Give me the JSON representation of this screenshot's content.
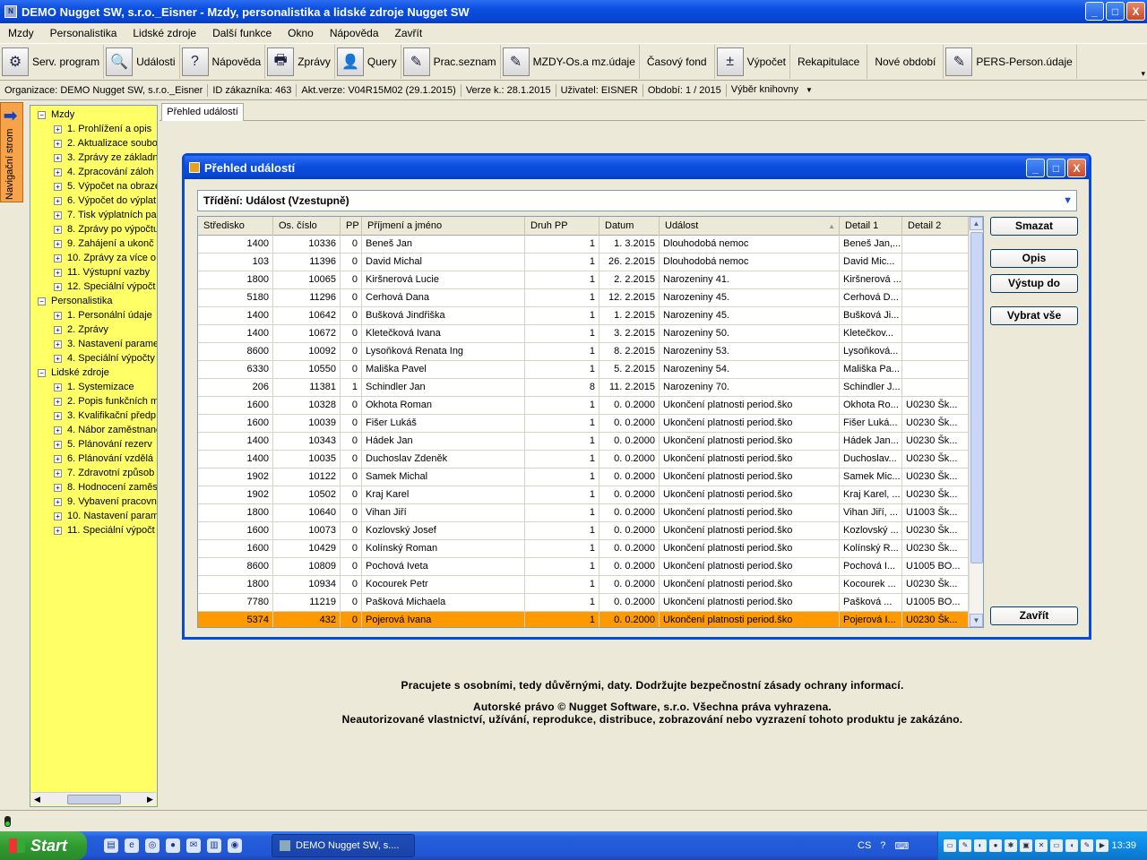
{
  "window": {
    "title": "DEMO Nugget SW, s.r.o._Eisner - Mzdy, personalistika a lidské zdroje Nugget SW",
    "minimize": "_",
    "maximize": "□",
    "close": "X"
  },
  "menu": [
    "Mzdy",
    "Personalistika",
    "Lidské zdroje",
    "Další funkce",
    "Okno",
    "Nápověda",
    "Zavřít"
  ],
  "toolbar": [
    {
      "label": "Serv. program",
      "icon": "gear-icon",
      "glyph": "⚙"
    },
    {
      "label": "Události",
      "icon": "magnifier-icon",
      "glyph": "🔍"
    },
    {
      "label": "Nápověda",
      "icon": "help-icon",
      "glyph": "?"
    },
    {
      "label": "Zprávy",
      "icon": "printer-icon",
      "glyph": "🖶"
    },
    {
      "label": "Query",
      "icon": "query-icon",
      "glyph": "👤"
    },
    {
      "label": "Prac.seznam",
      "icon": "document-icon",
      "glyph": "✎"
    },
    {
      "label": "MZDY-Os.a mz.údaje",
      "icon": "notepad-icon",
      "glyph": "✎"
    },
    {
      "label": "Časový fond",
      "icon": "",
      "glyph": ""
    },
    {
      "label": "Výpočet",
      "icon": "calculator-icon",
      "glyph": "±"
    },
    {
      "label": "Rekapitulace",
      "icon": "",
      "glyph": ""
    },
    {
      "label": "Nové období",
      "icon": "",
      "glyph": ""
    },
    {
      "label": "PERS-Person.údaje",
      "icon": "notepad-icon",
      "glyph": "✎"
    }
  ],
  "toolbar_more": "▾",
  "info": {
    "organizace": "Organizace: DEMO Nugget SW, s.r.o._Eisner",
    "id": "ID zákazníka: 463",
    "akt_verze": "Akt.verze: V04R15M02 (29.1.2015)",
    "verze_k": "Verze k.: 28.1.2015",
    "uzivatel": "Uživatel: EISNER",
    "obdobi": "Období: 1 / 2015",
    "knihovny": "Výběr knihovny"
  },
  "nav": {
    "label": "Navigační strom",
    "arrow": "➡",
    "tree": [
      {
        "level": 0,
        "label": "Mzdy",
        "exp": "−"
      },
      {
        "level": 1,
        "label": "1. Prohlížení a opis",
        "exp": "+"
      },
      {
        "level": 1,
        "label": "2. Aktualizace soubo",
        "exp": "+"
      },
      {
        "level": 1,
        "label": "3. Zprávy ze základn",
        "exp": "+"
      },
      {
        "level": 1,
        "label": "4. Zpracování záloh",
        "exp": "+"
      },
      {
        "level": 1,
        "label": "5. Výpočet na obraze",
        "exp": "+"
      },
      {
        "level": 1,
        "label": "6. Výpočet do výplat",
        "exp": "+"
      },
      {
        "level": 1,
        "label": "7. Tisk výplatních pa",
        "exp": "+"
      },
      {
        "level": 1,
        "label": "8. Zprávy po výpočtu",
        "exp": "+"
      },
      {
        "level": 1,
        "label": "9. Zahájení a ukonč",
        "exp": "+"
      },
      {
        "level": 1,
        "label": "10. Zprávy za více o",
        "exp": "+"
      },
      {
        "level": 1,
        "label": "11. Výstupní vazby",
        "exp": "+"
      },
      {
        "level": 1,
        "label": "12. Speciální výpočt",
        "exp": "+"
      },
      {
        "level": 0,
        "label": "Personalistika",
        "exp": "−"
      },
      {
        "level": 1,
        "label": "1. Personální údaje",
        "exp": "+"
      },
      {
        "level": 1,
        "label": "2. Zprávy",
        "exp": "+"
      },
      {
        "level": 1,
        "label": "3. Nastavení parame",
        "exp": "+"
      },
      {
        "level": 1,
        "label": "4. Speciální výpočty",
        "exp": "+"
      },
      {
        "level": 0,
        "label": "Lidské zdroje",
        "exp": "−"
      },
      {
        "level": 1,
        "label": "1. Systemizace",
        "exp": "+"
      },
      {
        "level": 1,
        "label": "2. Popis funkčních m",
        "exp": "+"
      },
      {
        "level": 1,
        "label": "3. Kvalifikační předp",
        "exp": "+"
      },
      {
        "level": 1,
        "label": "4. Nábor zaměstnanc",
        "exp": "+"
      },
      {
        "level": 1,
        "label": "5. Plánování rezerv",
        "exp": "+"
      },
      {
        "level": 1,
        "label": "6. Plánování vzdělá",
        "exp": "+"
      },
      {
        "level": 1,
        "label": "7. Zdravotní způsob",
        "exp": "+"
      },
      {
        "level": 1,
        "label": "8. Hodnocení zaměs",
        "exp": "+"
      },
      {
        "level": 1,
        "label": "9. Vybavení pracovn",
        "exp": "+"
      },
      {
        "level": 1,
        "label": "10. Nastavení param",
        "exp": "+"
      },
      {
        "level": 1,
        "label": "11. Speciální výpočt",
        "exp": "+"
      }
    ]
  },
  "mdi_tab": "Přehled událostí",
  "dialog": {
    "title": "Přehled událostí",
    "sort_label": "Třídění: Událost (Vzestupně)",
    "sort_arrow": "▼",
    "columns": [
      "Středisko",
      "Os. číslo",
      "PP",
      "Příjmení a jméno",
      "Druh PP",
      "Datum",
      "Událost",
      "Detail 1",
      "Detail 2"
    ],
    "sort_indicator": "▲",
    "rows": [
      [
        "1400",
        "10336",
        "0",
        "Beneš Jan",
        "1",
        "1. 3.2015",
        "Dlouhodobá nemoc",
        "Beneš Jan,...",
        ""
      ],
      [
        "103",
        "11396",
        "0",
        "David Michal",
        "1",
        "26. 2.2015",
        "Dlouhodobá nemoc",
        "David Mic...",
        ""
      ],
      [
        "1800",
        "10065",
        "0",
        "Kiršnerová Lucie",
        "1",
        "2. 2.2015",
        "Narozeniny 41.",
        "Kiršnerová ...",
        ""
      ],
      [
        "5180",
        "11296",
        "0",
        "Cerhová Dana",
        "1",
        "12. 2.2015",
        "Narozeniny 45.",
        "Cerhová D...",
        ""
      ],
      [
        "1400",
        "10642",
        "0",
        "Bušková Jindřiška",
        "1",
        "1. 2.2015",
        "Narozeniny 45.",
        "Bušková Ji...",
        ""
      ],
      [
        "1400",
        "10672",
        "0",
        "Kletečková Ivana",
        "1",
        "3. 2.2015",
        "Narozeniny 50.",
        "Kletečkov...",
        ""
      ],
      [
        "8600",
        "10092",
        "0",
        "Lysoňková Renata Ing",
        "1",
        "8. 2.2015",
        "Narozeniny 53.",
        "Lysoňková...",
        ""
      ],
      [
        "6330",
        "10550",
        "0",
        "Mališka Pavel",
        "1",
        "5. 2.2015",
        "Narozeniny 54.",
        "Mališka Pa...",
        ""
      ],
      [
        "206",
        "11381",
        "1",
        "Schindler Jan",
        "8",
        "11. 2.2015",
        "Narozeniny 70.",
        "Schindler J...",
        ""
      ],
      [
        "1600",
        "10328",
        "0",
        "Okhota Roman",
        "1",
        "0. 0.2000",
        "Ukončení platnosti period.ško",
        "Okhota Ro...",
        "U0230 Šk..."
      ],
      [
        "1600",
        "10039",
        "0",
        "Fišer Lukáš",
        "1",
        "0. 0.2000",
        "Ukončení platnosti period.ško",
        "Fišer Luká...",
        "U0230 Šk..."
      ],
      [
        "1400",
        "10343",
        "0",
        "Hádek Jan",
        "1",
        "0. 0.2000",
        "Ukončení platnosti period.ško",
        "Hádek Jan...",
        "U0230 Šk..."
      ],
      [
        "1400",
        "10035",
        "0",
        "Duchoslav Zdeněk",
        "1",
        "0. 0.2000",
        "Ukončení platnosti period.ško",
        "Duchoslav...",
        "U0230 Šk..."
      ],
      [
        "1902",
        "10122",
        "0",
        "Samek Michal",
        "1",
        "0. 0.2000",
        "Ukončení platnosti period.ško",
        "Samek Mic...",
        "U0230 Šk..."
      ],
      [
        "1902",
        "10502",
        "0",
        "Kraj Karel",
        "1",
        "0. 0.2000",
        "Ukončení platnosti period.ško",
        "Kraj Karel, ...",
        "U0230 Šk..."
      ],
      [
        "1800",
        "10640",
        "0",
        "Vihan Jiří",
        "1",
        "0. 0.2000",
        "Ukončení platnosti period.ško",
        "Vihan Jiří, ...",
        "U1003 Šk..."
      ],
      [
        "1600",
        "10073",
        "0",
        "Kozlovský Josef",
        "1",
        "0. 0.2000",
        "Ukončení platnosti period.ško",
        "Kozlovský ...",
        "U0230 Šk..."
      ],
      [
        "1600",
        "10429",
        "0",
        "Kolínský Roman",
        "1",
        "0. 0.2000",
        "Ukončení platnosti period.ško",
        "Kolínský R...",
        "U0230 Šk..."
      ],
      [
        "8600",
        "10809",
        "0",
        "Pochová Iveta",
        "1",
        "0. 0.2000",
        "Ukončení platnosti period.ško",
        "Pochová I...",
        "U1005 BO..."
      ],
      [
        "1800",
        "10934",
        "0",
        "Kocourek Petr",
        "1",
        "0. 0.2000",
        "Ukončení platnosti period.ško",
        "Kocourek ...",
        "U0230 Šk..."
      ],
      [
        "7780",
        "11219",
        "0",
        "Pašková Michaela",
        "1",
        "0. 0.2000",
        "Ukončení platnosti period.ško",
        "Pašková ...",
        "U1005 BO..."
      ],
      [
        "5374",
        "432",
        "0",
        "Pojerová Ivana",
        "1",
        "0. 0.2000",
        "Ukončení platnosti period.ško",
        "Pojerová I...",
        "U0230 Šk..."
      ]
    ],
    "selected_row": 21,
    "buttons": {
      "delete": "Smazat",
      "detail": "Opis",
      "output": "Výstup do",
      "select_all": "Vybrat vše",
      "close": "Zavřít"
    },
    "scroll_up": "▲",
    "scroll_down": "▼"
  },
  "notice": {
    "line1": "Pracujete s osobními, tedy důvěrnými, daty. Dodržujte bezpečnostní zásady ochrany informací.",
    "line2": "Autorské právo © Nugget Software, s.r.o. Všechna práva vyhrazena.",
    "line3": "Neautorizované vlastnictví, užívání, reprodukce, distribuce, zobrazování nebo vyzrazení tohoto produktu je zakázáno."
  },
  "taskbar": {
    "start": "Start",
    "task": "DEMO Nugget SW, s....",
    "lang": "CS",
    "clock": "13:39"
  },
  "colors": {
    "tree_bg": "#ffff66",
    "selected_row": "#ff9900",
    "title_blue": "#0a4ee0",
    "nav_tab": "#f7a34a"
  }
}
